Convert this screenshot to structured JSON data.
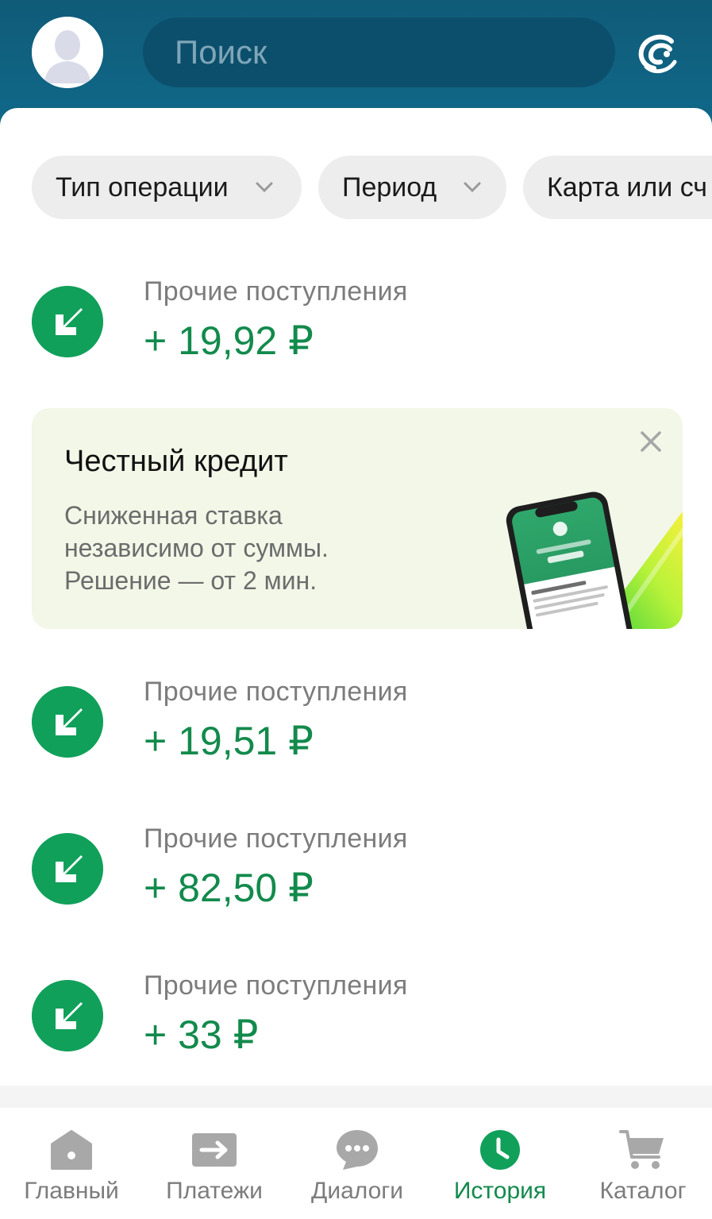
{
  "header": {
    "search_placeholder": "Поиск",
    "avatar_icon": "user-silhouette-icon",
    "logo_icon": "sber-logo-icon",
    "colors": {
      "header_bg": "#11698a",
      "search_bg": "#0c4f6c"
    }
  },
  "filters": [
    {
      "label": "Тип операции"
    },
    {
      "label": "Период"
    },
    {
      "label": "Карта или сч"
    }
  ],
  "operations": [
    {
      "label": "Прочие поступления",
      "amount": "+ 19,92 ₽",
      "icon": "incoming-arrow-icon"
    },
    {
      "label": "Прочие поступления",
      "amount": "+ 19,51 ₽",
      "icon": "incoming-arrow-icon"
    },
    {
      "label": "Прочие поступления",
      "amount": "+ 82,50 ₽",
      "icon": "incoming-arrow-icon"
    },
    {
      "label": "Прочие поступления",
      "amount": "+ 33 ₽",
      "icon": "incoming-arrow-icon"
    }
  ],
  "promo": {
    "title": "Честный кредит",
    "text": "Сниженная ставка независимо от суммы. Решение — от 2 мин.",
    "close_icon": "close-icon"
  },
  "tabbar": [
    {
      "label": "Главный",
      "icon": "home-icon",
      "active": false
    },
    {
      "label": "Платежи",
      "icon": "payments-arrow-icon",
      "active": false
    },
    {
      "label": "Диалоги",
      "icon": "chat-bubble-icon",
      "active": false
    },
    {
      "label": "История",
      "icon": "clock-icon",
      "active": true
    },
    {
      "label": "Каталог",
      "icon": "cart-icon",
      "active": false
    }
  ],
  "colors": {
    "accent": "#128a4c",
    "icon_green": "#10a05a",
    "inactive": "#7c7c7c"
  }
}
